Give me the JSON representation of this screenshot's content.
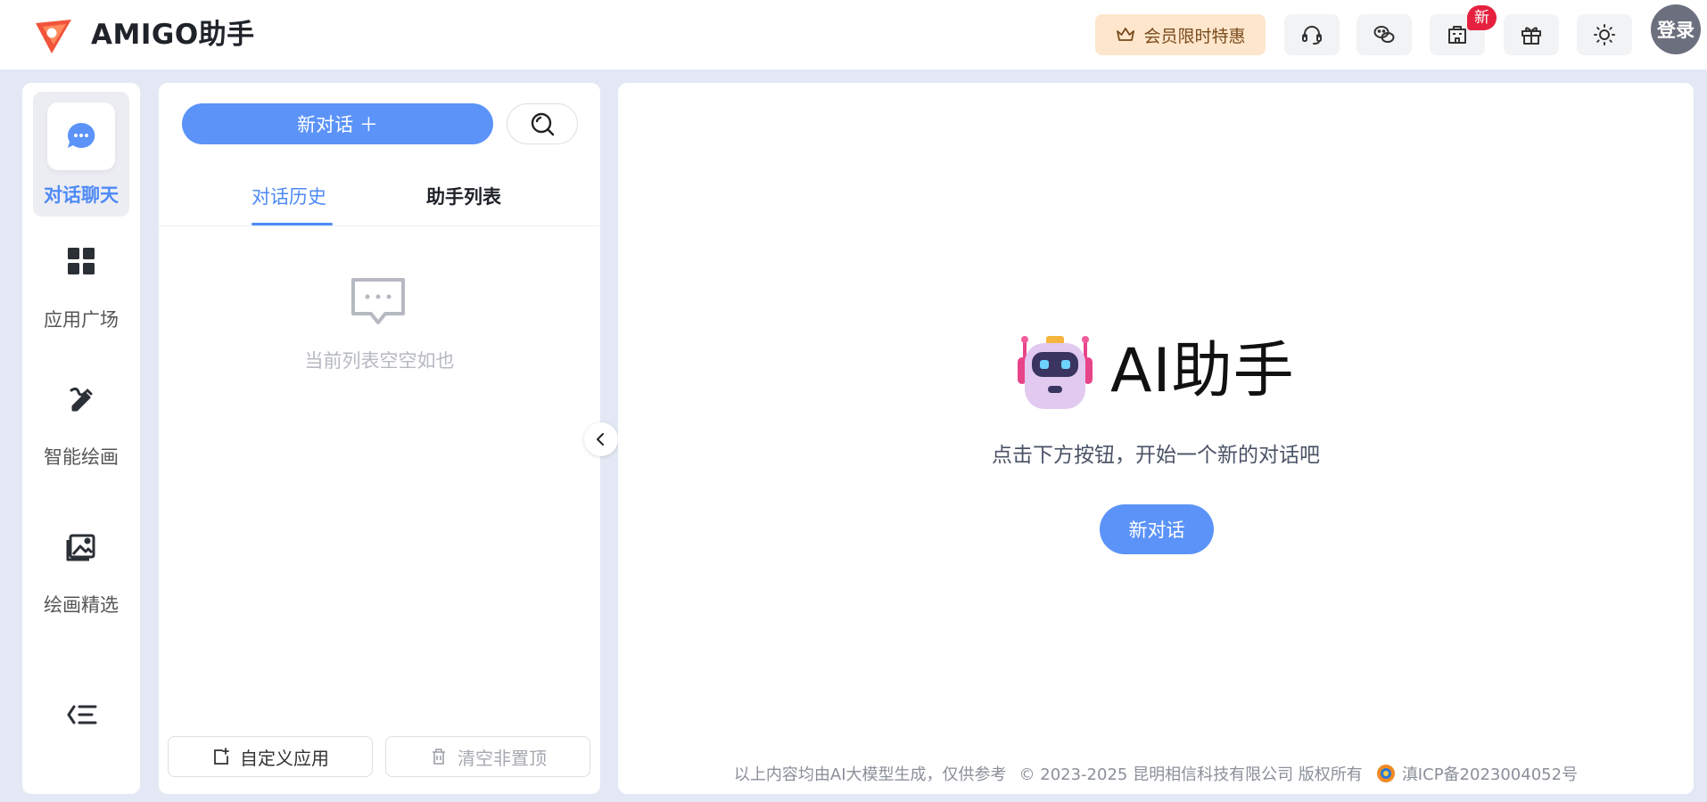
{
  "header": {
    "brand": "AMIGO助手",
    "vip_label": "会员限时特惠",
    "badge": "新",
    "login": "登录"
  },
  "nav": {
    "items": [
      {
        "label": "对话聊天",
        "icon": "chat-bubble-icon",
        "active": true
      },
      {
        "label": "应用广场",
        "icon": "apps-grid-icon"
      },
      {
        "label": "智能绘画",
        "icon": "pen-draw-icon"
      },
      {
        "label": "绘画精选",
        "icon": "image-gallery-icon"
      }
    ]
  },
  "panel": {
    "new_chat": "新对话 ＋",
    "tabs": [
      {
        "label": "对话历史",
        "active": true
      },
      {
        "label": "助手列表"
      }
    ],
    "empty_text": "当前列表空空如也",
    "custom_app": "自定义应用",
    "clear_unpinned": "清空非置顶"
  },
  "main": {
    "title": "AI助手",
    "subtitle": "点击下方按钮，开始一个新的对话吧",
    "new_chat": "新对话",
    "footer": {
      "disclaimer": "以上内容均由AI大模型生成，仅供参考",
      "copyright": "© 2023-2025 昆明相信科技有限公司 版权所有",
      "icp": "滇ICP备2023004052号"
    }
  },
  "colors": {
    "accent": "#5b93f8",
    "vip_bg": "#fde6cc",
    "badge": "#e5213f",
    "page_bg": "#e3e8f4"
  }
}
